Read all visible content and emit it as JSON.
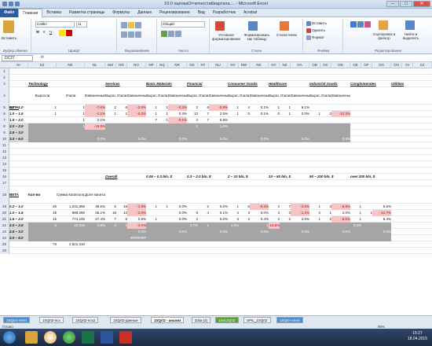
{
  "window": {
    "title": "10.0 оценкаОтчетностиКвартала.... - Microsoft Excel"
  },
  "ribbon_tabs": [
    "Файл",
    "Главная",
    "Вставка",
    "Разметка страницы",
    "Формулы",
    "Данные",
    "Рецензирование",
    "Вид",
    "Разработчик",
    "Acrobat"
  ],
  "ribbon": {
    "paste": "Вставить",
    "clipboard": "Буфер обмена",
    "font_name": "Calibri",
    "font_size": "11",
    "font_group": "Шрифт",
    "align_group": "Выравнивание",
    "number_format": "Общий",
    "number_group": "Число",
    "cond_format": "Условное форматирование",
    "format_table": "Форматировать как таблицу",
    "cell_styles": "Стили ячеек",
    "styles_group": "Стили",
    "insert": "Вставить",
    "delete": "Удалить",
    "format": "Формат",
    "cells_group": "Ячейки",
    "sort_filter": "Сортировка и фильтр",
    "find_select": "Найти и выделить",
    "editing_group": "Редактирование"
  },
  "formula_bar": {
    "cell_ref": "DC27",
    "fx": "fx"
  },
  "columns": [
    "NI",
    "NJ",
    "NK",
    "NL",
    "NM",
    "NN",
    "NO",
    "NP",
    "NQ",
    "NR",
    "NS",
    "NT",
    "NU",
    "NV",
    "NW",
    "NX",
    "NY",
    "NZ",
    "OA",
    "OB",
    "OC",
    "OD",
    "OE",
    "OF",
    "OG",
    "OH",
    "OI",
    "OJ"
  ],
  "rows": [
    "1",
    "2",
    "3",
    "4",
    "5",
    "6",
    "7",
    "8",
    "9",
    "10",
    "11",
    "12",
    "13",
    "14",
    "15",
    "16",
    "17",
    "18",
    "19",
    "20",
    "21",
    "22",
    "23",
    "24",
    "25",
    "26"
  ],
  "top_table": {
    "sectors": [
      "Technology",
      "Services",
      "Basic Materials",
      "Financial",
      "Consumer Goods",
      "Healthcare",
      "Industrial Goods",
      "Conglomerates",
      "Utilities"
    ],
    "beta_label": "BETA",
    "sub_headers": [
      "Выросли",
      "Упали",
      "Взвешенный рост"
    ],
    "beta_rows": [
      "0.2 – 1.0",
      "1.0 – 1.5",
      "1.5 – 2.0",
      "2.0 – 2.5",
      "2.5 – 3.0",
      "3.0 – 6.0"
    ],
    "data": [
      [
        "1",
        "1",
        "-7.6%",
        "2",
        "6",
        "-2.5%",
        "1",
        "1",
        "-0.3%",
        "2",
        "6",
        "-0.8%",
        "1",
        "4",
        "0.1%",
        "1",
        "1",
        "6.1%",
        "",
        "",
        ""
      ],
      [
        "1",
        "1",
        "-1.1%",
        "1",
        "1",
        "-0.2%",
        "1",
        "1",
        "0.3%",
        "13",
        "7",
        "2.5%",
        "1",
        "0",
        "0.1%",
        "0",
        "1",
        "0.0%",
        "1",
        "2",
        "-12.3%"
      ],
      [
        "",
        "1",
        "2.1%",
        "",
        "",
        "",
        "7",
        "1",
        "-0.1%",
        "4",
        "7",
        "0.5%",
        "",
        "",
        "",
        "",
        "",
        "",
        "",
        "",
        ""
      ],
      [
        "",
        "1",
        "-15.9%",
        "",
        "",
        "",
        "",
        "",
        "",
        "1",
        "",
        "1.0%",
        "",
        "",
        "",
        "",
        "",
        "",
        "",
        "",
        ""
      ],
      [
        "",
        "",
        "",
        "",
        "",
        "",
        "",
        "",
        "",
        "",
        "",
        "",
        "",
        "",
        "",
        "",
        "",
        "",
        "",
        "",
        ""
      ],
      [
        "",
        "",
        "0.0%",
        "",
        "",
        "0.0%",
        "",
        "",
        "0.0%",
        "",
        "",
        "0.0%",
        "",
        "",
        "0.0%",
        "",
        "",
        "0.0%",
        "",
        "",
        "0.0%"
      ]
    ]
  },
  "bottom_table": {
    "overall": "Overall",
    "caps": [
      "0.05 – 0.3 bln, $",
      "0.3 – 2.0 bln, $",
      "2 – 10 bln, $",
      "10 – 50 bln, $",
      "50 – 200 bln, $",
      "over 200 bln, $"
    ],
    "beta_label": "BETA",
    "count_label": "Кол-во",
    "sum_label": "Сумма Капитала",
    "share_label": "Доля капитала",
    "beta_rows": [
      "0.2 – 1.0",
      "1.0 – 1.5",
      "1.5 – 2.0",
      "2.0 – 2.5",
      "2.5 – 3.0",
      "3.0 – 6.0"
    ],
    "data": [
      [
        "25",
        "1,031,855",
        "36.6%",
        "6",
        "19",
        "-1.9%",
        "1",
        "1",
        "0.0%",
        "",
        "2",
        "0.0%",
        "1",
        "6",
        "-0.3%",
        "2",
        "7",
        "-4.5%",
        "1",
        "3",
        "-6.8%",
        "1",
        "",
        "6.6%"
      ],
      [
        "18",
        "989,290",
        "35.1%",
        "18",
        "12",
        "-2.0%",
        "",
        "",
        "0.0%",
        "8",
        "4",
        "0.1%",
        "4",
        "3",
        "0.0%",
        "3",
        "3",
        "-1.2%",
        "2",
        "1",
        "2.0%",
        "1",
        "1",
        "-11.7%"
      ],
      [
        "15",
        "774,245",
        "27.4%",
        "7",
        "8",
        "0.6%",
        "1",
        "",
        "0.0%",
        "2",
        "",
        "0.0%",
        "3",
        "3",
        "0.4%",
        "2",
        "2",
        "2.0%",
        "1",
        "2",
        "-6.5%",
        "1",
        "",
        "6.4%"
      ],
      [
        "5",
        "26,020",
        "0.9%",
        "2",
        "1",
        "-4.5%",
        "",
        "",
        "",
        "0.7%",
        "1",
        "",
        "1.0%",
        "",
        "1",
        "-16.6%",
        "",
        "",
        "",
        "",
        "",
        "0.0%",
        "",
        ""
      ],
      [
        "",
        "",
        "",
        "",
        "",
        "0.0%",
        "",
        "",
        "0.0%",
        "",
        "",
        "0.0%",
        "",
        "",
        "0.0%",
        "",
        "",
        "0.0%",
        "",
        "",
        "0.0%",
        "",
        "",
        "0.0%"
      ],
      [
        "",
        "",
        "",
        "",
        "",
        "########",
        "",
        "",
        "",
        "",
        "",
        "",
        "",
        "",
        "",
        "",
        "",
        "",
        "",
        "",
        "",
        "",
        "",
        ""
      ]
    ],
    "total_count": "73",
    "total_sum": "2,821,410"
  },
  "sheet_tabs": [
    "1SQrt-t-HHH",
    "1SQrt2-ncx",
    "1SQrt2-ncx2",
    "1SQrt2-данные",
    "1SQrt2 - анализ",
    "Data (2)",
    "1Sec2Qrt2",
    "SPIL_1SQrt2",
    "1SQrt-t-HHH"
  ],
  "status": {
    "ready": "Готово",
    "zoom": "95%"
  },
  "taskbar": {
    "time": "15:27",
    "date": "18.04.2015"
  },
  "colors": {
    "gray": "#a5a5a5",
    "pink": "#f4c6c6",
    "red": "#c00000",
    "ribbon_blue": "#2a5aa8"
  }
}
